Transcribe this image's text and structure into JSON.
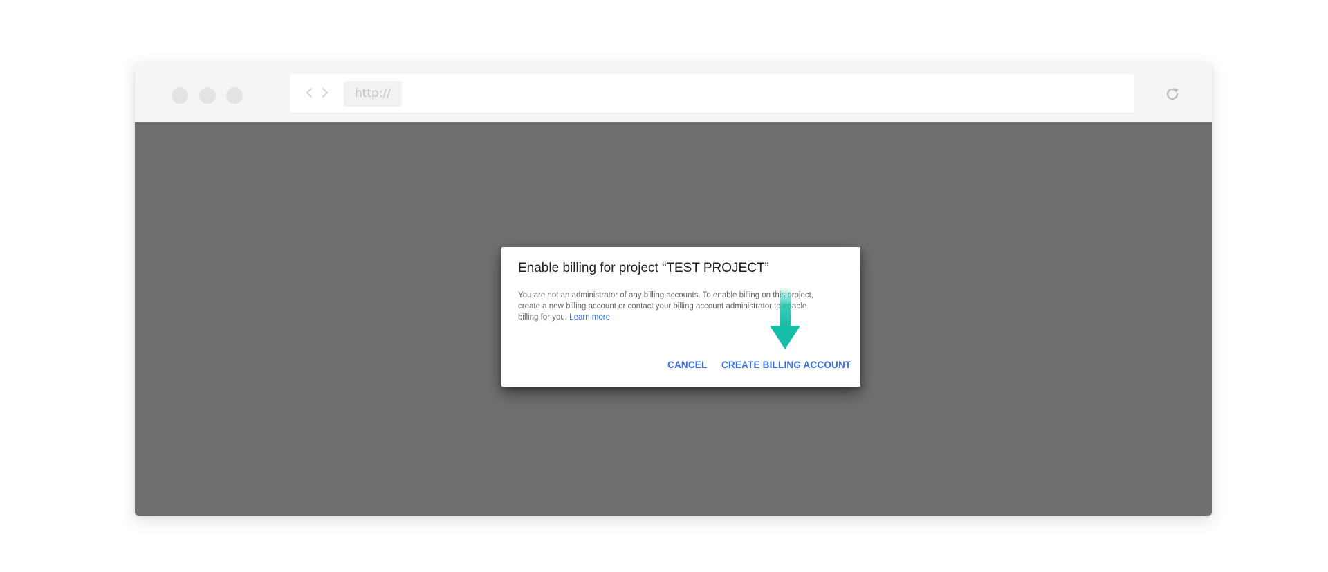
{
  "browser": {
    "url_text": "http://",
    "icons": {
      "back": "chevron-left-icon",
      "forward": "chevron-right-icon",
      "reload": "reload-icon"
    }
  },
  "dialog": {
    "title": "Enable billing for project “TEST PROJECT”",
    "body_text": "You are not an administrator of any billing accounts. To enable billing on this project, create a new billing account or contact your billing account administrator to enable billing for you.",
    "learn_more": "Learn more",
    "cancel_label": "CANCEL",
    "create_label": "CREATE BILLING ACCOUNT"
  },
  "colors": {
    "link": "#3b6fd8",
    "overlay": "#707070",
    "pointer_arrow": "#18c4b0"
  }
}
